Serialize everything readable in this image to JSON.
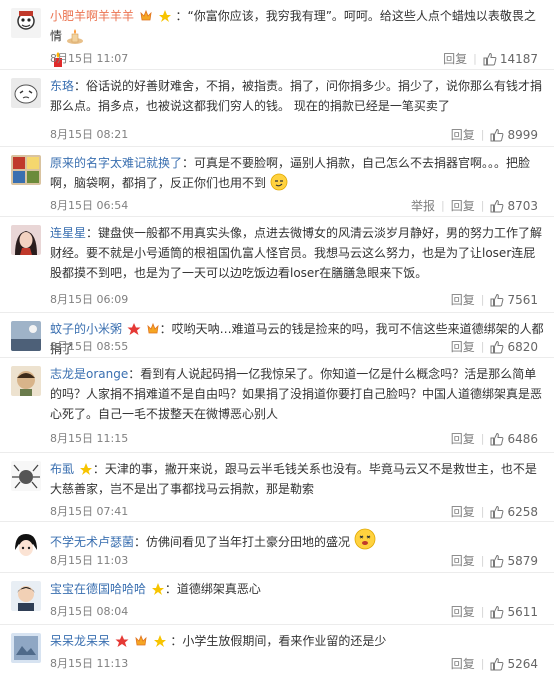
{
  "comments": [
    {
      "user": "小肥羊啊羊羊羊",
      "text": "：“你富你应该，我穷我有理”。呵呵。给这些人点个蜡烛以表敬畏之情",
      "time": "8月15日 11:07",
      "likes": "14187",
      "reply": "回复"
    },
    {
      "user": "东珞",
      "text": "：俗话说的好善财难舍，不捐，被指责。捐了，问你捐多少。捐少了，说你那么有钱才捐那么点。捐多点，也被说这都我们穷人的钱。 现在的捐款已经是一笔买卖了",
      "time": "8月15日 08:21",
      "likes": "8999",
      "reply": "回复"
    },
    {
      "user": "原来的名字太难记就换了",
      "text": "：可真是不要脸啊，逼别人捐款，自己怎么不去捐器官啊。。。把脸啊，脑袋啊，都捐了，反正你们也用不到",
      "time": "8月15日 06:54",
      "likes": "8703",
      "reply": "回复",
      "report": "举报"
    },
    {
      "user": "连星星",
      "text": "：键盘侠一般都不用真实头像，点进去微博女的风清云淡岁月静好，男的努力工作了解财经。要不就是小号遁筒的根祖国仇富人怪官员。我想马云这么努力，也是为了让loser连屁股都摸不到吧，也是为了一天可以边吃饭边看loser在膳膳急眼来下饭。",
      "time": "8月15日 06:09",
      "likes": "7561",
      "reply": "回复"
    },
    {
      "user": "蚊子的小米粥",
      "text": "：哎哟天呐…难道马云的钱是捡来的吗，我可不信这些来道德绑架的人都捐了",
      "time": "8月15日 08:55",
      "likes": "6820",
      "reply": "回复"
    },
    {
      "user": "志龙是orange",
      "text": "：看到有人说起码捐一亿我惊呆了。你知道一亿是什么概念吗？活是那么简单的吗？人家捐不捐难道不是自由吗？如果捐了没捐道你要打自己脸吗？中国人道德绑架真是恶心死了。自己一毛不拔整天在微博恶心别人",
      "time": "8月15日 11:15",
      "likes": "6486",
      "reply": "回复"
    },
    {
      "user": "布虱",
      "text": "：天津的事，撇开来说，跟马云半毛钱关系也没有。毕竟马云又不是救世主，也不是大慈善家，岂不是出了事都找马云捐款，那是勒索",
      "time": "8月15日 07:41",
      "likes": "6258",
      "reply": "回复"
    },
    {
      "user": "不学无术卢瑟菌",
      "text": "：仿佛间看见了当年打土豪分田地的盛况",
      "time": "8月15日 11:03",
      "likes": "5879",
      "reply": "回复"
    },
    {
      "user": "宝宝在德国哈哈哈",
      "text": "：道德绑架真恶心",
      "time": "8月15日 08:04",
      "likes": "5611",
      "reply": "回复"
    },
    {
      "user": "呆呆龙呆呆",
      "text": "：小学生放假期间，看来作业留的还是少",
      "time": "8月15日 11:13",
      "likes": "5264",
      "reply": "回复"
    }
  ],
  "colors": {
    "username": "#eb7350",
    "link": "#3a6fb0",
    "meta": "#808080"
  }
}
